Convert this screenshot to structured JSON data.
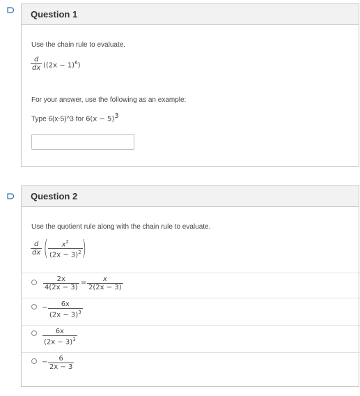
{
  "q1": {
    "title": "Question 1",
    "instruction": "Use the chain rule to evaluate.",
    "d_num": "d",
    "d_den": "dx",
    "expr": "((2x − 1)",
    "expr_exp": "6",
    "expr_close": ")",
    "answer_note": "For your answer, use the following as an example:",
    "type_prefix": "Type 6(x-5)^3 for ",
    "type_math": "6(x − 5)",
    "type_math_exp": "3",
    "answer_value": ""
  },
  "q2": {
    "title": "Question 2",
    "instruction": "Use the quotient rule along with the chain rule to evaluate.",
    "d_num": "d",
    "d_den": "dx",
    "frac_num": "x",
    "frac_num_exp": "2",
    "frac_den": "(2x − 3)",
    "frac_den_exp": "2",
    "options": [
      {
        "n1": "2x",
        "d1": "4(2x − 3)",
        "eq": "=",
        "n2": "x",
        "d2": "2(2x − 3)"
      },
      {
        "sign": "−",
        "n": "6x",
        "d": "(2x − 3)",
        "d_exp": "3"
      },
      {
        "n": "6x",
        "d": "(2x − 3)",
        "d_exp": "3"
      },
      {
        "sign": "−",
        "n": "6",
        "d": "2x − 3"
      }
    ]
  },
  "colors": {
    "flag": "#2b6cb0",
    "header_bg": "#f2f2f2",
    "border": "#c8c8c8"
  },
  "icons": {
    "flag": "flag-icon",
    "radio": "radio-button"
  }
}
